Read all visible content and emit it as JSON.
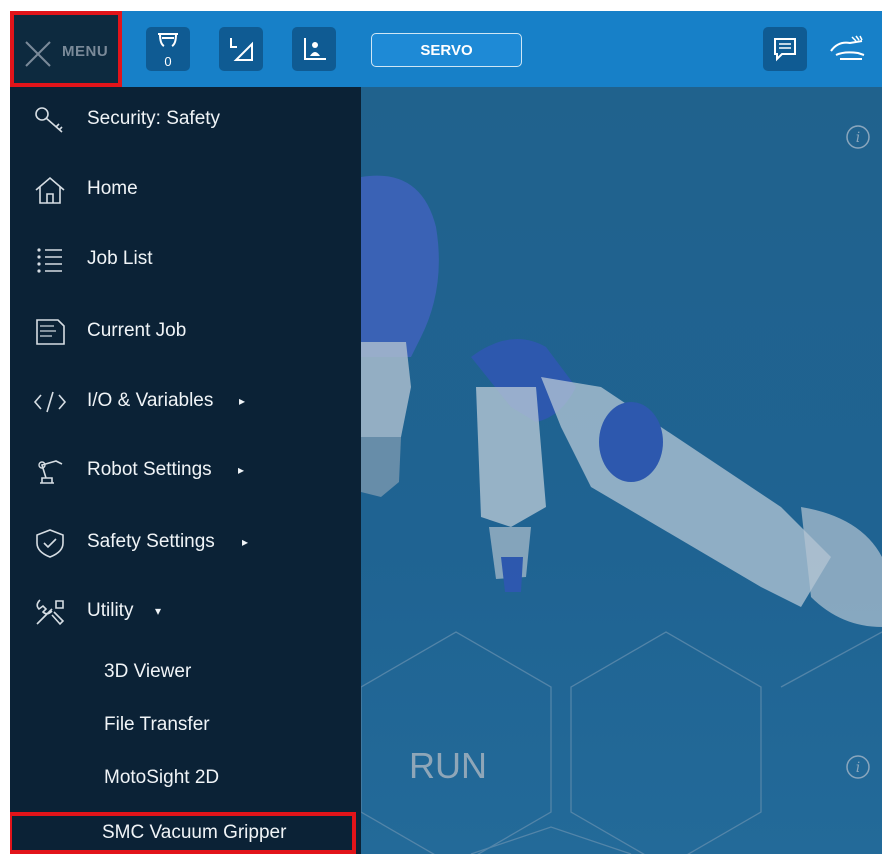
{
  "topbar": {
    "menu_label": "MENU",
    "tool_counter": "0",
    "servo_label": "SERVO",
    "icons": [
      "close-icon",
      "gripper-tool-icon",
      "frame-icon",
      "user-frame-icon",
      "message-icon",
      "hand-guide-icon"
    ]
  },
  "menu": {
    "items": [
      {
        "label": "Security: Safety",
        "icon": "key-icon"
      },
      {
        "label": "Home",
        "icon": "home-icon"
      },
      {
        "label": "Job List",
        "icon": "list-icon"
      },
      {
        "label": "Current Job",
        "icon": "job-file-icon"
      },
      {
        "label": "I/O & Variables",
        "icon": "code-icon",
        "has_submenu": true
      },
      {
        "label": "Robot Settings",
        "icon": "robot-arm-icon",
        "has_submenu": true
      },
      {
        "label": "Safety Settings",
        "icon": "shield-check-icon",
        "has_submenu": true
      },
      {
        "label": "Utility",
        "icon": "tools-icon",
        "expanded": true
      }
    ],
    "submenu_arrow": "▸",
    "expanded_arrow": "▾",
    "utility_subitems": [
      "3D Viewer",
      "File Transfer",
      "MotoSight 2D",
      "SMC Vacuum Gripper"
    ]
  },
  "content": {
    "run_label": "RUN"
  },
  "colors": {
    "topbar": "#1780c8",
    "menu_bg": "#0b2236",
    "highlight": "#e2141a",
    "content_bg": "#1f6392"
  }
}
